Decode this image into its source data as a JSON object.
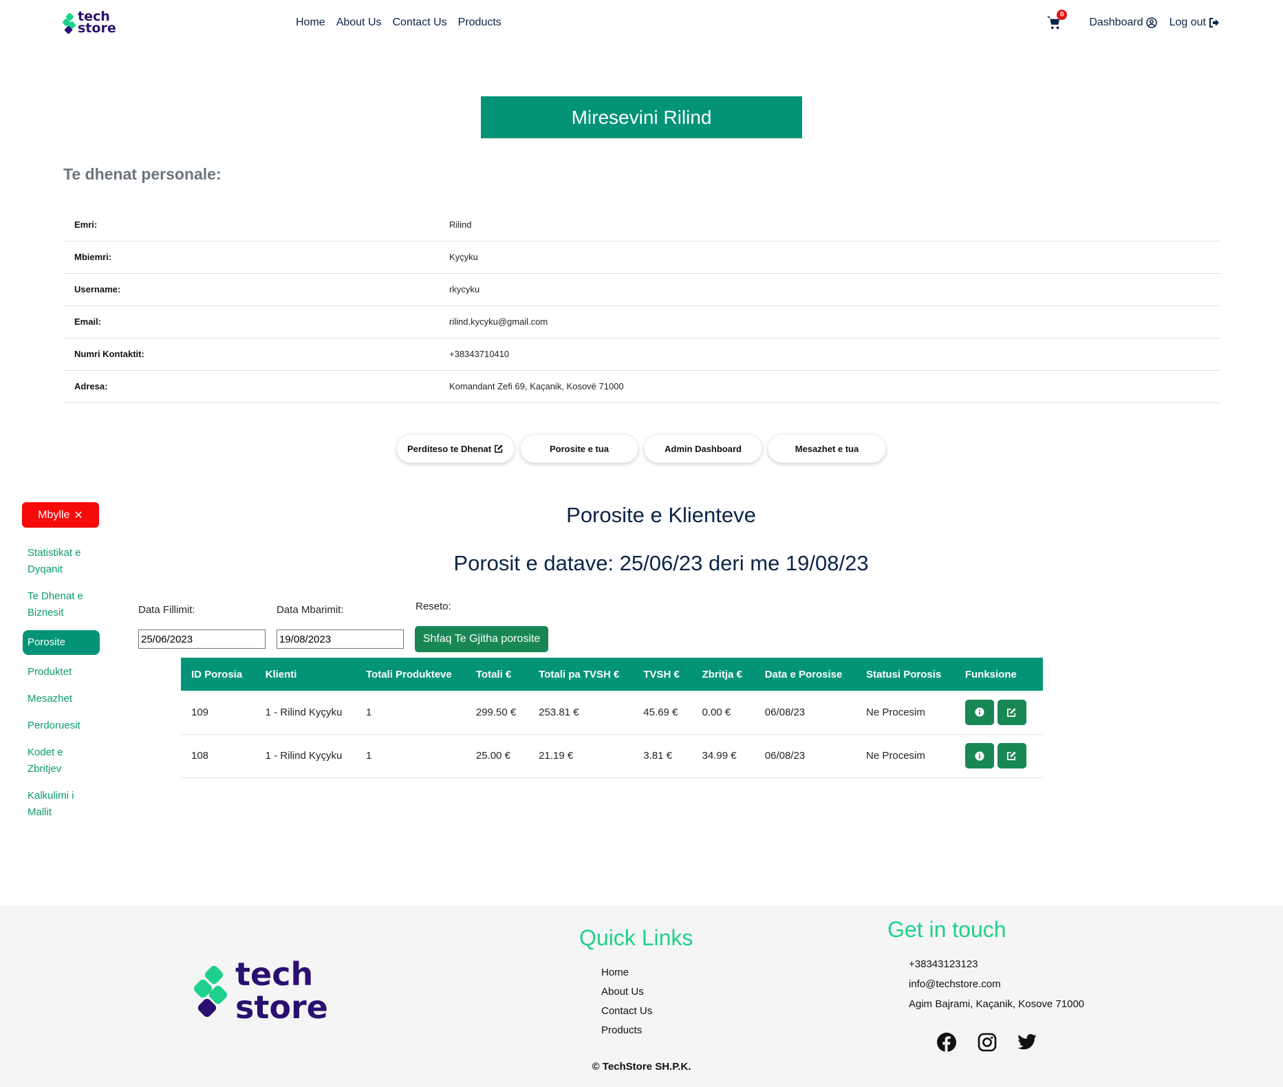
{
  "brand": {
    "line1": "tech",
    "line2": "store",
    "colors": {
      "green": "#1dd18c",
      "purple": "#2a1070"
    }
  },
  "nav": {
    "links": [
      "Home",
      "About Us",
      "Contact Us",
      "Products"
    ],
    "cart_count": "0",
    "dashboard": "Dashboard",
    "logout": "Log out"
  },
  "welcome": "Miresevini Rilind",
  "personal": {
    "heading": "Te dhenat personale:",
    "rows": [
      {
        "label": "Emri:",
        "value": "Rilind"
      },
      {
        "label": "Mbiemri:",
        "value": "Kyçyku"
      },
      {
        "label": "Username:",
        "value": "rkycyku"
      },
      {
        "label": "Email:",
        "value": "rilind.kycyku@gmail.com"
      },
      {
        "label": "Numri Kontaktit:",
        "value": "+38343710410"
      },
      {
        "label": "Adresa:",
        "value": "Komandant Zefi 69, Kaçanik, Kosovë 71000"
      }
    ]
  },
  "actions": [
    "Perditeso te Dhenat",
    "Porosite e tua",
    "Admin Dashboard",
    "Mesazhet e tua"
  ],
  "sidebar": {
    "close": "Mbylle",
    "items": [
      "Statistikat e Dyqanit",
      "Te Dhenat e Biznesit",
      "Porosite",
      "Produktet",
      "Mesazhet",
      "Perdoruesit",
      "Kodet e Zbritjev",
      "Kalkulimi i Mallit"
    ],
    "active_index": 2
  },
  "orders": {
    "title": "Porosite e Klienteve",
    "subtitle": "Porosit e datave: 25/06/23 deri me 19/08/23",
    "filters": {
      "start_label": "Data Fillimit:",
      "start_value": "25/06/2023",
      "end_label": "Data Mbarimit:",
      "end_value": "19/08/2023",
      "reset_label": "Reseto:",
      "show_all": "Shfaq Te Gjitha porosite"
    },
    "columns": [
      "ID Porosia",
      "Klienti",
      "Totali Produkteve",
      "Totali €",
      "Totali pa TVSH €",
      "TVSH €",
      "Zbritja €",
      "Data e Porosise",
      "Statusi Porosis",
      "Funksione"
    ],
    "rows": [
      [
        "109",
        "1 - Rilind Kyçyku",
        "1",
        "299.50 €",
        "253.81 €",
        "45.69 €",
        "0.00 €",
        "06/08/23",
        "Ne Procesim"
      ],
      [
        "108",
        "1 - Rilind Kyçyku",
        "1",
        "25.00 €",
        "21.19 €",
        "3.81 €",
        "34.99 €",
        "06/08/23",
        "Ne Procesim"
      ]
    ]
  },
  "footer": {
    "quick_links_title": "Quick Links",
    "quick_links": [
      "Home",
      "About Us",
      "Contact Us",
      "Products"
    ],
    "contact_title": "Get in touch",
    "contact": [
      "+38343123123",
      "info@techstore.com",
      "Agim Bajrami, Kaçanik, Kosove 71000"
    ],
    "socials": [
      "facebook-icon",
      "instagram-icon",
      "twitter-icon"
    ],
    "copyright": "TechStore SH.P.K."
  }
}
